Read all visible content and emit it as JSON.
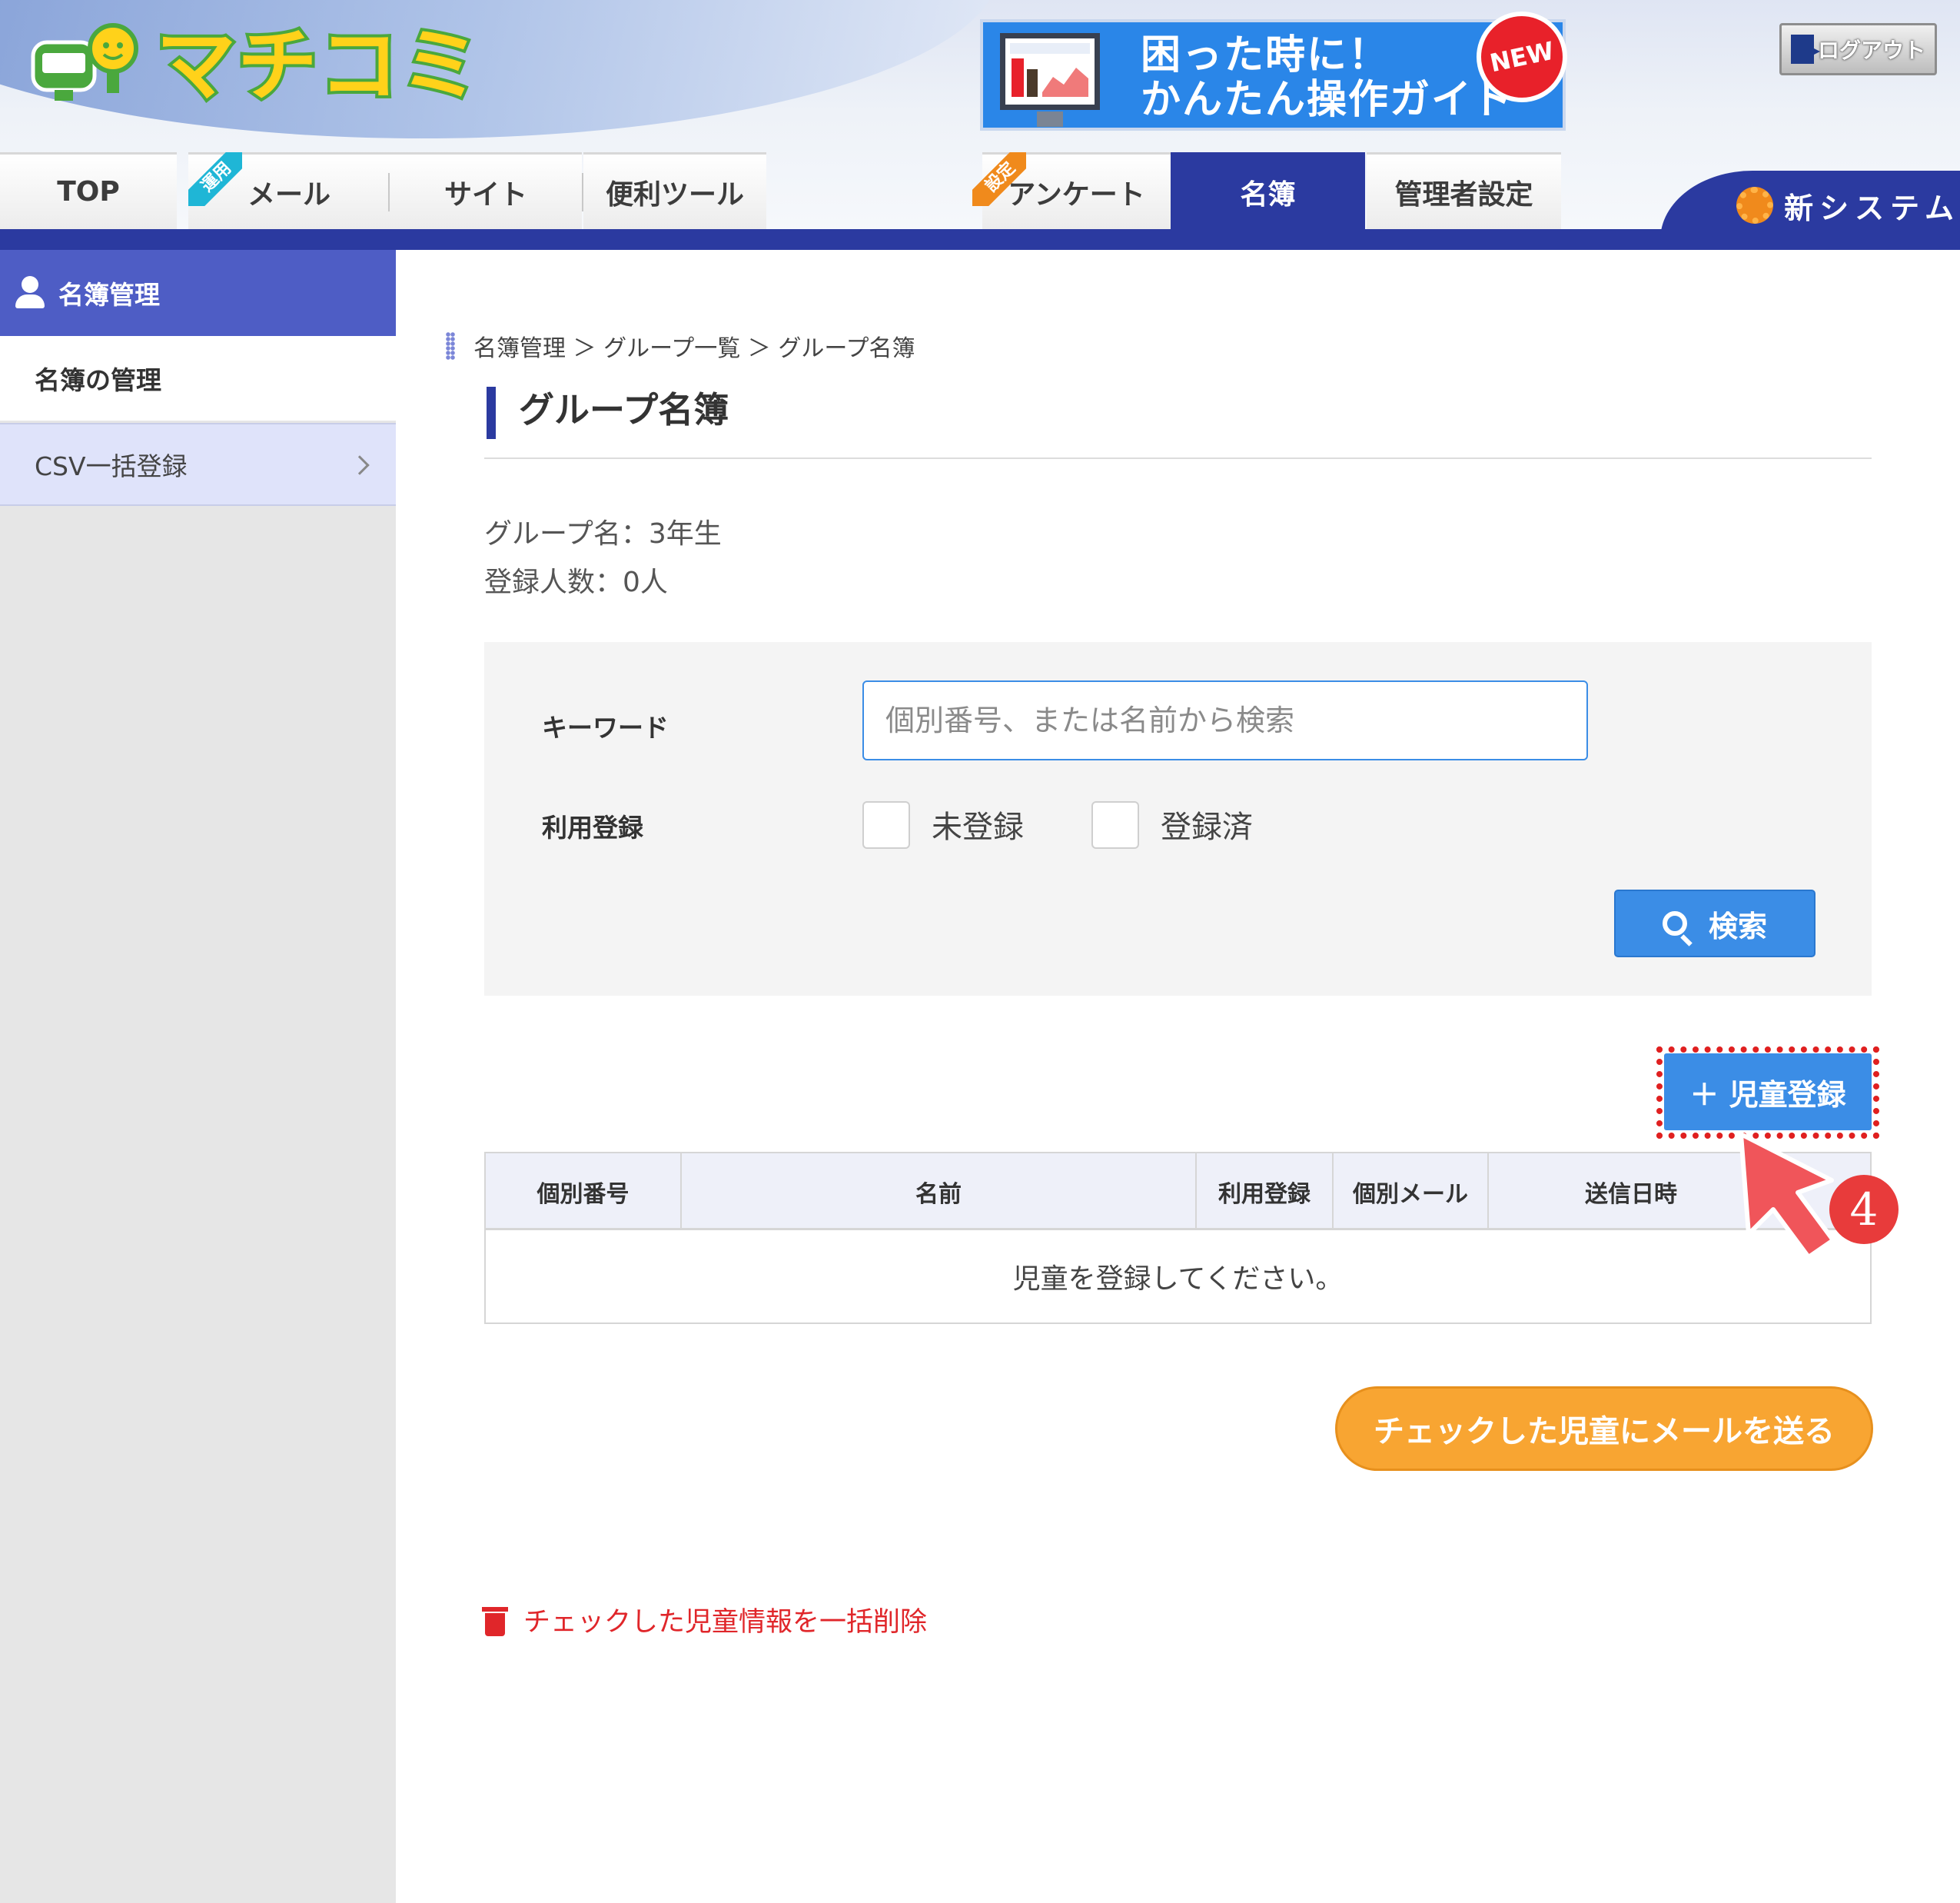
{
  "header": {
    "logo_text": "マチコミ",
    "guide_banner": {
      "line1": "困った時に！",
      "line2": "かんたん操作ガイド",
      "badge": "NEW"
    },
    "logout_label": "ログアウト",
    "new_system_label": "新システム"
  },
  "tabs": [
    {
      "label": "TOP"
    },
    {
      "label": "メール",
      "ribbon": "運用"
    },
    {
      "label": "サイト"
    },
    {
      "label": "便利ツール"
    },
    {
      "label": "アンケート",
      "ribbon": "設定"
    },
    {
      "label": "名簿",
      "active": true
    },
    {
      "label": "管理者設定"
    }
  ],
  "sidebar": {
    "heading": "名簿管理",
    "items": [
      {
        "label": "名簿の管理"
      },
      {
        "label": "CSV一括登録"
      }
    ]
  },
  "breadcrumb": "名簿管理 ＞ グループ一覧 ＞ グループ名簿",
  "page_title": "グループ名簿",
  "group_info": {
    "group_name": "グループ名：3年生",
    "member_count": "登録人数：0人"
  },
  "search": {
    "keyword_label": "キーワード",
    "keyword_placeholder": "個別番号、または名前から検索",
    "registration_label": "利用登録",
    "options": [
      "未登録",
      "登録済"
    ],
    "button_label": "検索"
  },
  "register_button_label": "＋ 児童登録",
  "step_badge": "4",
  "table": {
    "columns": [
      "個別番号",
      "名前",
      "利用登録",
      "個別メール",
      "送信日時"
    ],
    "empty_message": "児童を登録してください。"
  },
  "send_mail_button_label": "チェックした児童にメールを送る",
  "bulk_delete_label": "チェックした児童情報を一括削除",
  "colors": {
    "navy": "#2b3aa0",
    "blue_button": "#3b8de6",
    "orange_button": "#f8a532",
    "danger_red": "#e0262a",
    "sidebar_head": "#4e5dc5"
  }
}
